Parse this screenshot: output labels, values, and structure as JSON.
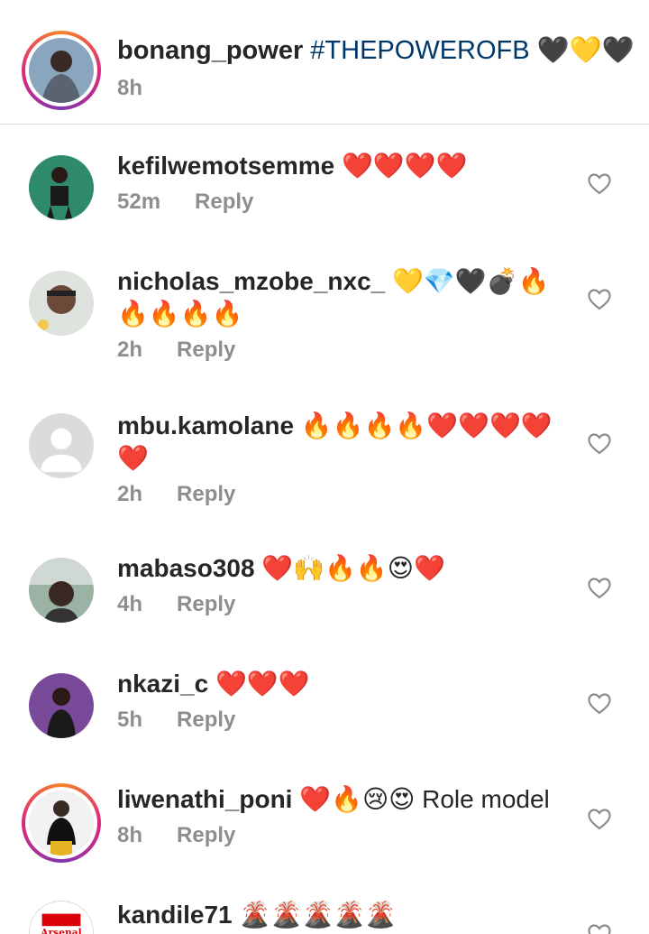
{
  "caption": {
    "username": "bonang_power",
    "hashtag": "#THEPOWEROFB",
    "emojis": "🖤💛🖤",
    "time": "8h"
  },
  "comments": [
    {
      "username": "kefilwemotsemme",
      "text": "❤️❤️❤️❤️",
      "time": "52m",
      "reply": "Reply"
    },
    {
      "username": "nicholas_mzobe_nxc_",
      "text": "💛💎🖤💣🔥🔥🔥🔥🔥",
      "time": "2h",
      "reply": "Reply"
    },
    {
      "username": "mbu.kamolane",
      "text": "🔥🔥🔥🔥❤️❤️❤️❤️❤️",
      "time": "2h",
      "reply": "Reply"
    },
    {
      "username": "mabaso308",
      "text": "❤️🙌🔥🔥😍❤️",
      "time": "4h",
      "reply": "Reply"
    },
    {
      "username": "nkazi_c",
      "text": "❤️❤️❤️",
      "time": "5h",
      "reply": "Reply"
    },
    {
      "username": "liwenathi_poni",
      "text": "❤️🔥😢😍 Role model",
      "time": "8h",
      "reply": "Reply"
    },
    {
      "username": "kandile71",
      "text": "🌋🌋🌋🌋🌋",
      "time": "",
      "reply": ""
    }
  ],
  "avatar_labels": {
    "kandile71": "Arsenal"
  },
  "colors": {
    "text": "#262626",
    "muted": "#8e8e8e",
    "hashtag": "#00376b",
    "divider": "#dbdbdb"
  },
  "icons": {
    "like": "heart-outline-icon",
    "placeholder_avatar": "default-user-icon"
  }
}
